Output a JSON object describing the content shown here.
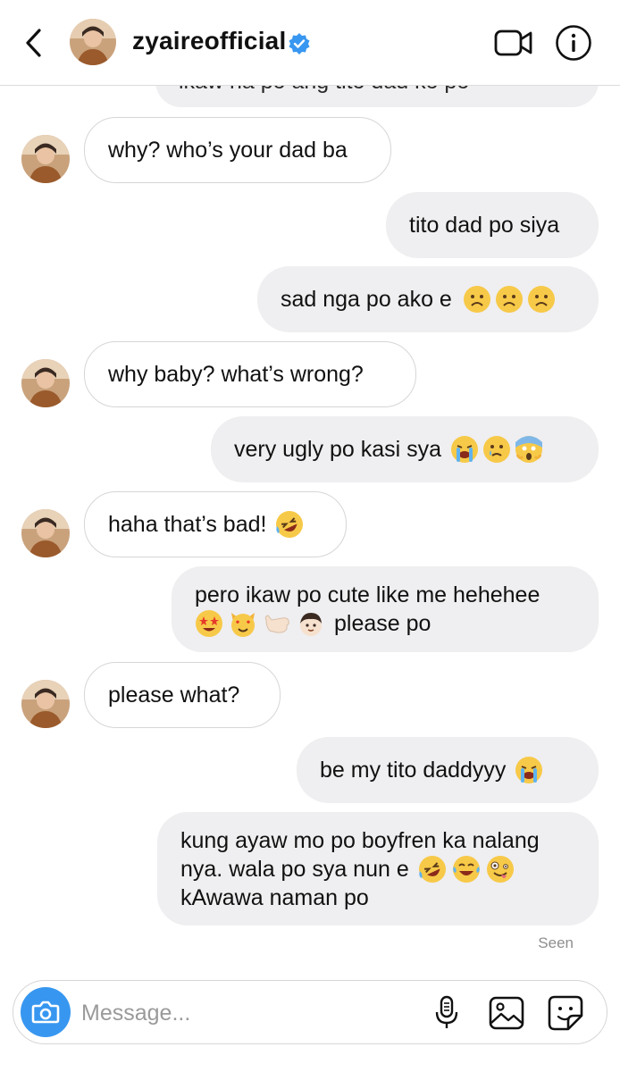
{
  "header": {
    "username": "zyaireofficial",
    "back_icon": "chevron-left-icon",
    "verified_icon": "verified-badge-icon",
    "video_icon": "video-camera-icon",
    "info_icon": "info-icon",
    "accent_color": "#3897f0"
  },
  "messages": [
    {
      "side": "out",
      "text": "ikaw na po ang tito dad ko po",
      "partial": true
    },
    {
      "side": "in",
      "text": "why? who’s your dad ba"
    },
    {
      "side": "out",
      "text": "tito dad po siya"
    },
    {
      "side": "out",
      "text": "sad nga po ako e",
      "emoji": [
        "frowning-face",
        "frowning-face",
        "frowning-face"
      ]
    },
    {
      "side": "in",
      "text": "why baby? what’s wrong?"
    },
    {
      "side": "out",
      "text": "very ugly po kasi sya",
      "emoji": [
        "loudly-crying-face",
        "crying-face",
        "face-screaming-in-fear"
      ]
    },
    {
      "side": "in",
      "text": "haha that’s bad!",
      "emoji": [
        "rolling-on-the-floor-laughing"
      ]
    },
    {
      "side": "out",
      "line1": "pero ikaw po cute like me hehehee",
      "line2": "please po",
      "emoji": [
        "star-struck",
        "smiling-cat-heart-eyes",
        "call-me-hand",
        "boy"
      ]
    },
    {
      "side": "in",
      "text": "please what?"
    },
    {
      "side": "out",
      "text": "be my tito daddyyy",
      "emoji": [
        "loudly-crying-face"
      ]
    },
    {
      "side": "out",
      "line1": "kung ayaw mo po boyfren ka nalang",
      "line2": "nya. wala po sya nun e",
      "line3": "kAwawa naman po",
      "emoji": [
        "rolling-on-the-floor-laughing",
        "face-with-tears-of-joy",
        "zany-face"
      ]
    }
  ],
  "status": {
    "seen": "Seen"
  },
  "composer": {
    "placeholder": "Message...",
    "camera_icon": "camera-icon",
    "mic_icon": "microphone-icon",
    "gallery_icon": "image-icon",
    "sticker_icon": "sticker-icon",
    "camera_color": "#3797f0"
  }
}
